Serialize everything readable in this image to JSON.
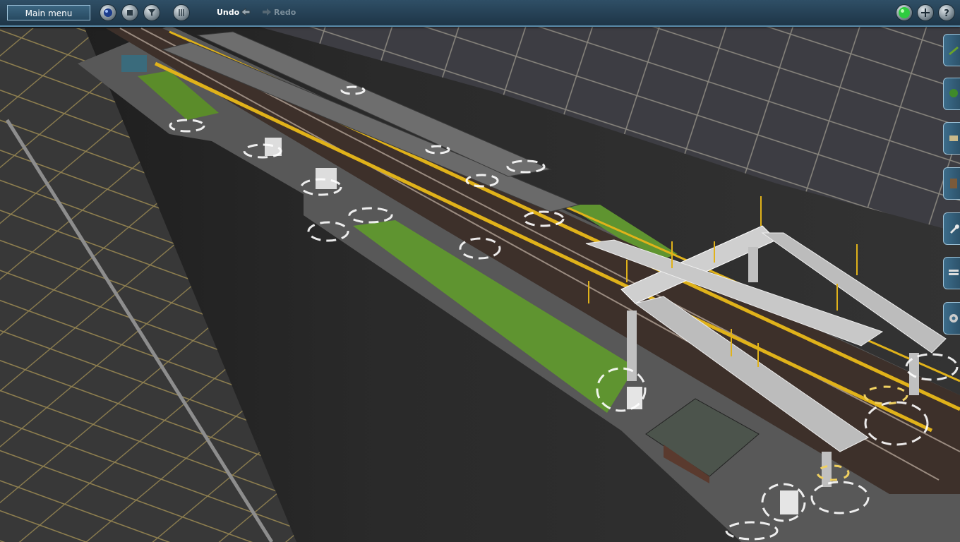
{
  "toolbar": {
    "main_menu_label": "Main menu",
    "undo_label": "Undo",
    "redo_label": "Redo",
    "left_buttons": [
      {
        "name": "planet-icon"
      },
      {
        "name": "stop-icon"
      },
      {
        "name": "filter-icon"
      },
      {
        "name": "grid-icon"
      }
    ],
    "right_buttons": [
      {
        "name": "status-light-icon",
        "color": "#2ecc40"
      },
      {
        "name": "add-icon"
      },
      {
        "name": "help-icon"
      }
    ]
  },
  "palette": [
    {
      "name": "track-tool-icon"
    },
    {
      "name": "scenery-tool-icon"
    },
    {
      "name": "object-tool-icon"
    },
    {
      "name": "layers-tool-icon"
    },
    {
      "name": "wrench-tool-icon"
    },
    {
      "name": "stack-tool-icon"
    },
    {
      "name": "settings-tool-icon"
    }
  ],
  "colors": {
    "toolbar_bg": "#1e3547",
    "platform_yellow": "#e0b21a",
    "grass": "#5b8c2a"
  }
}
